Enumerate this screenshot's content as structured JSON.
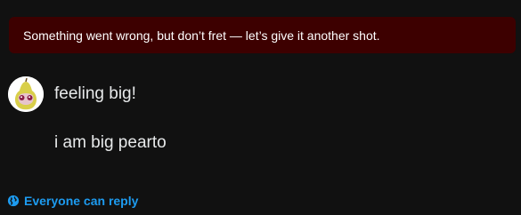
{
  "error": {
    "message": "Something went wrong, but don’t fret — let’s give it another shot."
  },
  "post": {
    "lines": [
      "feeling big!",
      "i am big pearto"
    ]
  },
  "reply": {
    "icon": "globe-icon",
    "label": "Everyone can reply"
  },
  "colors": {
    "background": "#111111",
    "error_bg": "#3d0000",
    "accent": "#1d9bf0",
    "text": "#e7e9ea"
  }
}
